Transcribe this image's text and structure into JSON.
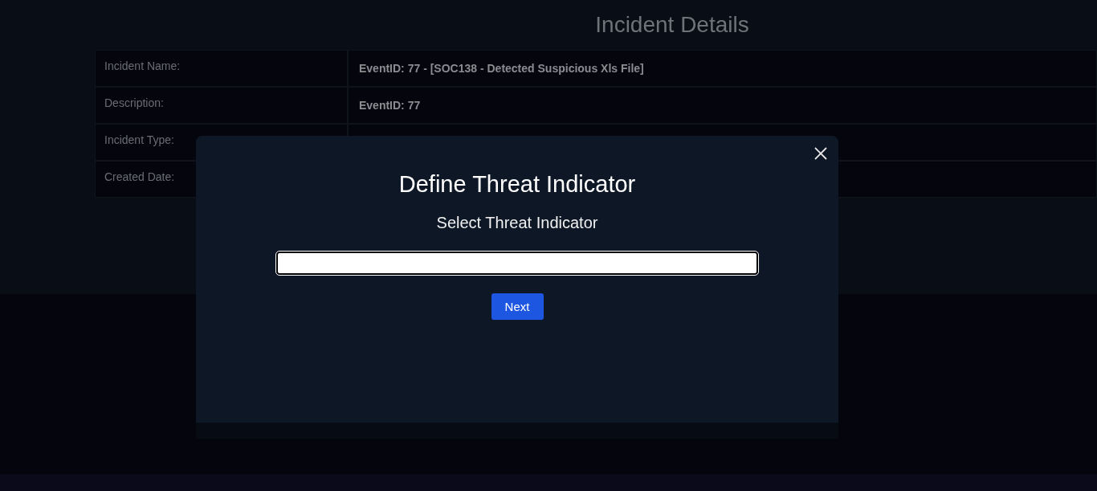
{
  "page": {
    "title": "Incident Details"
  },
  "details": [
    {
      "label": "Incident Name:",
      "value": "EventID: 77 - [SOC138 - Detected Suspicious Xls File]"
    },
    {
      "label": "Description:",
      "value": "EventID: 77"
    },
    {
      "label": "Incident Type:"
    },
    {
      "label": "Created Date:"
    }
  ],
  "modal": {
    "title": "Define Threat Indicator",
    "subtitle": "Select Threat Indicator",
    "button": "Next"
  }
}
